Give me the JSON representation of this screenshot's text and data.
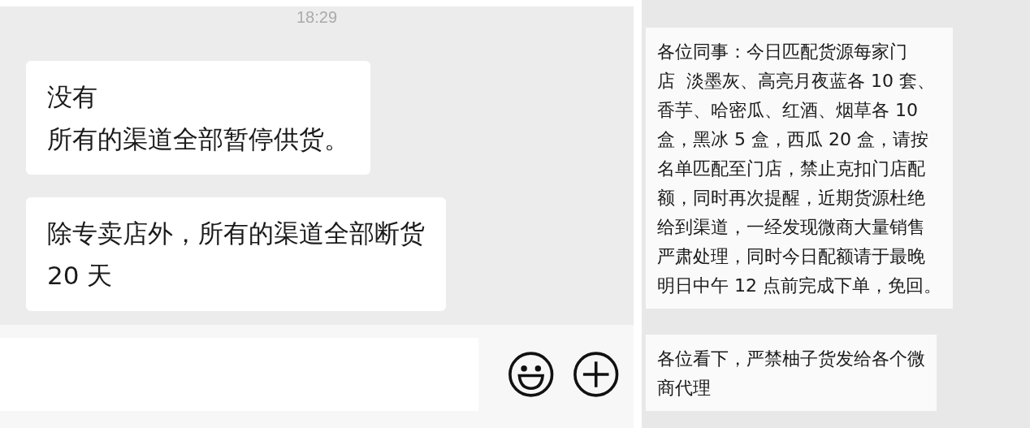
{
  "left_chat": {
    "time": "18:29",
    "messages": [
      {
        "lines": [
          "没有",
          "所有的渠道全部暂停供货。"
        ]
      },
      {
        "lines": [
          "除专卖店外，所有的渠道全部断货",
          "20 天"
        ]
      }
    ]
  },
  "right_chat": {
    "messages": [
      {
        "lines": [
          "各位同事：今日匹配货源每家门",
          "店  淡墨灰、高亮月夜蓝各 10 套、",
          "香芋、哈密瓜、红酒、烟草各 10",
          "盒，黑冰 5 盒，西瓜 20 盒，请按",
          "名单匹配至门店，禁止克扣门店配",
          "额，同时再次提醒，近期货源杜绝",
          "给到渠道，一经发现微商大量销售",
          "严肃处理，同时今日配额请于最晚",
          "明日中午 12 点前完成下单，免回。"
        ]
      },
      {
        "lines": [
          "各位看下，严禁柚子货发给各个微",
          "商代理"
        ]
      }
    ]
  }
}
